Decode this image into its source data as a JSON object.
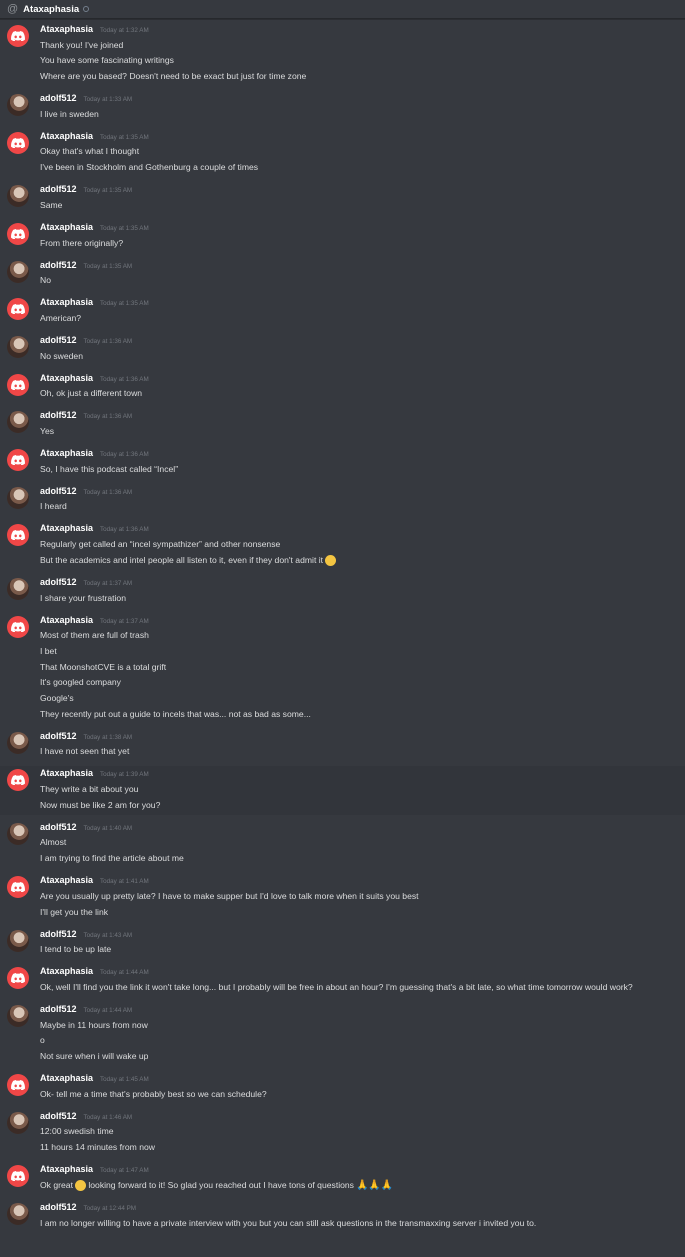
{
  "header": {
    "channel": "Ataxaphasia"
  },
  "messages": [
    {
      "author": "Ataxaphasia",
      "avatar": "discord-logo-icon",
      "time": "Today at 1:32 AM",
      "lines": [
        "Thank you! I've joined",
        "You have some fascinating writings",
        "Where are you based? Doesn't need to be exact but just for time zone"
      ]
    },
    {
      "author": "adolf512",
      "avatar": "user-avatar",
      "time": "Today at 1:33 AM",
      "lines": [
        "I live in sweden"
      ]
    },
    {
      "author": "Ataxaphasia",
      "avatar": "discord-logo-icon",
      "time": "Today at 1:35 AM",
      "lines": [
        "Okay that's what I thought",
        "I've been in Stockholm and Gothenburg a couple of times"
      ]
    },
    {
      "author": "adolf512",
      "avatar": "user-avatar",
      "time": "Today at 1:35 AM",
      "lines": [
        "Same"
      ]
    },
    {
      "author": "Ataxaphasia",
      "avatar": "discord-logo-icon",
      "time": "Today at 1:35 AM",
      "lines": [
        "From there originally?"
      ]
    },
    {
      "author": "adolf512",
      "avatar": "user-avatar",
      "time": "Today at 1:35 AM",
      "lines": [
        "No"
      ]
    },
    {
      "author": "Ataxaphasia",
      "avatar": "discord-logo-icon",
      "time": "Today at 1:35 AM",
      "lines": [
        "American?"
      ]
    },
    {
      "author": "adolf512",
      "avatar": "user-avatar",
      "time": "Today at 1:36 AM",
      "lines": [
        "No sweden"
      ]
    },
    {
      "author": "Ataxaphasia",
      "avatar": "discord-logo-icon",
      "time": "Today at 1:36 AM",
      "lines": [
        "Oh, ok just a different town"
      ]
    },
    {
      "author": "adolf512",
      "avatar": "user-avatar",
      "time": "Today at 1:36 AM",
      "lines": [
        "Yes"
      ]
    },
    {
      "author": "Ataxaphasia",
      "avatar": "discord-logo-icon",
      "time": "Today at 1:36 AM",
      "lines": [
        "So, I have this podcast called “Incel”"
      ]
    },
    {
      "author": "adolf512",
      "avatar": "user-avatar",
      "time": "Today at 1:36 AM",
      "lines": [
        "I heard"
      ]
    },
    {
      "author": "Ataxaphasia",
      "avatar": "discord-logo-icon",
      "time": "Today at 1:36 AM",
      "lines": [
        "Regularly get called an “incel sympathizer” and other nonsense",
        "But the academics and intel people all listen to it, even if they don't admit it"
      ],
      "emoji_line": 1
    },
    {
      "author": "adolf512",
      "avatar": "user-avatar",
      "time": "Today at 1:37 AM",
      "lines": [
        "I share your frustration"
      ]
    },
    {
      "author": "Ataxaphasia",
      "avatar": "discord-logo-icon",
      "time": "Today at 1:37 AM",
      "lines": [
        "Most of them are full of trash",
        "I bet",
        "That MoonshotCVE is a total grift",
        "It's googled company",
        "Google's",
        "They recently put out a guide to incels that was... not as bad as some..."
      ]
    },
    {
      "author": "adolf512",
      "avatar": "user-avatar",
      "time": "Today at 1:38 AM",
      "lines": [
        "I have not seen that yet"
      ]
    },
    {
      "author": "Ataxaphasia",
      "avatar": "discord-logo-icon",
      "time": "Today at 1:39 AM",
      "lines": [
        "They write a bit about you",
        "Now must be like 2 am for you?"
      ],
      "highlight": true
    },
    {
      "author": "adolf512",
      "avatar": "user-avatar",
      "time": "Today at 1:40 AM",
      "lines": [
        "Almost",
        "I am trying to find the article about me"
      ]
    },
    {
      "author": "Ataxaphasia",
      "avatar": "discord-logo-icon",
      "time": "Today at 1:41 AM",
      "lines": [
        "Are you usually up pretty late? I have to make supper but I'd love to talk more when it suits you best",
        "I'll get you the link"
      ]
    },
    {
      "author": "adolf512",
      "avatar": "user-avatar",
      "time": "Today at 1:43 AM",
      "lines": [
        "I tend to be up late"
      ]
    },
    {
      "author": "Ataxaphasia",
      "avatar": "discord-logo-icon",
      "time": "Today at 1:44 AM",
      "lines": [
        "Ok, well I'll find you the link it won't take long... but I probably will be free in about an hour? I'm guessing that's a bit late, so what time tomorrow would work?"
      ]
    },
    {
      "author": "adolf512",
      "avatar": "user-avatar",
      "time": "Today at 1:44 AM",
      "lines": [
        "Maybe in 11 hours from now",
        "o",
        "Not sure when i will wake up"
      ]
    },
    {
      "author": "Ataxaphasia",
      "avatar": "discord-logo-icon",
      "time": "Today at 1:45 AM",
      "lines": [
        "Ok- tell me a time that's probably best so we can schedule?"
      ]
    },
    {
      "author": "adolf512",
      "avatar": "user-avatar",
      "time": "Today at 1:46 AM",
      "lines": [
        "12:00 swedish time",
        "11 hours 14 minutes from now"
      ]
    },
    {
      "author": "Ataxaphasia",
      "avatar": "discord-logo-icon",
      "time": "Today at 1:47 AM",
      "lines": [
        "Ok great",
        "looking forward to it! So glad you reached out I have tons of questions"
      ],
      "inline_pair": true
    },
    {
      "author": "adolf512",
      "avatar": "user-avatar",
      "time": "Today at 12:44 PM",
      "lines": [
        "I am no longer willing to have a private interview with you but you can still ask questions in the transmaxxing server i invited you to."
      ]
    }
  ]
}
